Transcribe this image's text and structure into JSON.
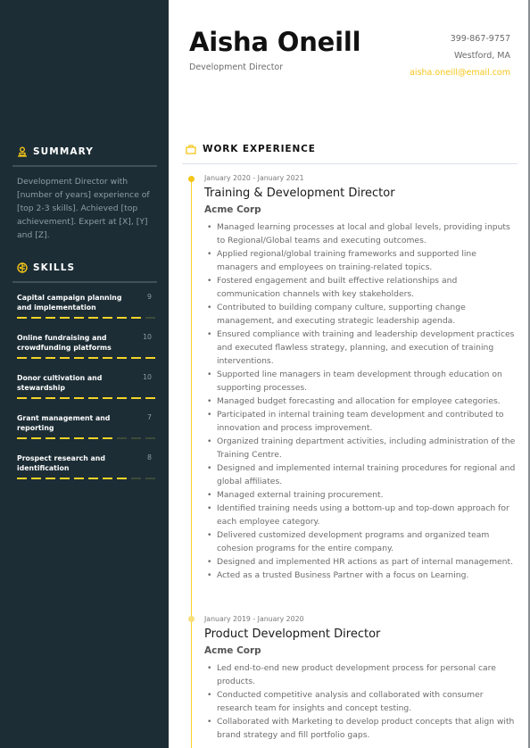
{
  "header": {
    "name": "Aisha Oneill",
    "role": "Development Director",
    "phone": "399-867-9757",
    "location": "Westford, MA",
    "email": "aisha.oneill@email.com"
  },
  "colors": {
    "sidebar": "#1c2d35",
    "accent": "#f5c518"
  },
  "sidebar": {
    "summary": {
      "icon": "user-icon",
      "title": "SUMMARY",
      "text": "Development Director with [number of years] experience of [top 2-3 skills]. Achieved [top achievement]. Expert at [X], [Y] and [Z]."
    },
    "skills": {
      "icon": "skills-icon",
      "title": "SKILLS",
      "max": 10,
      "items": [
        {
          "name": "Capital campaign planning and implementation",
          "score": "9",
          "level": 9
        },
        {
          "name": "Online fundraising and crowdfunding platforms",
          "score": "10",
          "level": 10
        },
        {
          "name": "Donor cultivation and stewardship",
          "score": "10",
          "level": 10
        },
        {
          "name": "Grant management and reporting",
          "score": "7",
          "level": 7
        },
        {
          "name": "Prospect research and identification",
          "score": "8",
          "level": 8
        }
      ]
    }
  },
  "work": {
    "icon": "briefcase-icon",
    "title": "WORK EXPERIENCE",
    "jobs": [
      {
        "dates": "January 2020 - January 2021",
        "title": "Training & Development Director",
        "company": "Acme Corp",
        "bullets": [
          "Managed learning processes at local and global levels, providing inputs to Regional/Global teams and executing outcomes.",
          "Applied regional/global training frameworks and supported line managers and employees on training-related topics.",
          "Fostered engagement and built effective relationships and communication channels with key stakeholders.",
          "Contributed to building company culture, supporting change management, and executing strategic leadership agenda.",
          "Ensured compliance with training and leadership development practices and executed flawless strategy, planning, and execution of training interventions.",
          "Supported line managers in team development through education on supporting processes.",
          "Managed budget forecasting and allocation for employee categories.",
          "Participated in internal training team development and contributed to innovation and process improvement.",
          "Organized training department activities, including administration of the Training Centre.",
          "Designed and implemented internal training procedures for regional and global affiliates.",
          "Managed external training procurement.",
          "Identified training needs using a bottom-up and top-down approach for each employee category.",
          "Delivered customized development programs and organized team cohesion programs for the entire company.",
          "Designed and implemented HR actions as part of internal management.",
          "Acted as a trusted Business Partner with a focus on Learning."
        ]
      },
      {
        "dates": "January 2019 - January 2020",
        "title": "Product Development Director",
        "company": "Acme Corp",
        "bullets": [
          "Led end-to-end new product development process for personal care products.",
          "Conducted competitive analysis and collaborated with consumer research team for insights and concept testing.",
          "Collaborated with Marketing to develop product concepts that align with brand strategy and fill portfolio gaps."
        ]
      }
    ]
  }
}
